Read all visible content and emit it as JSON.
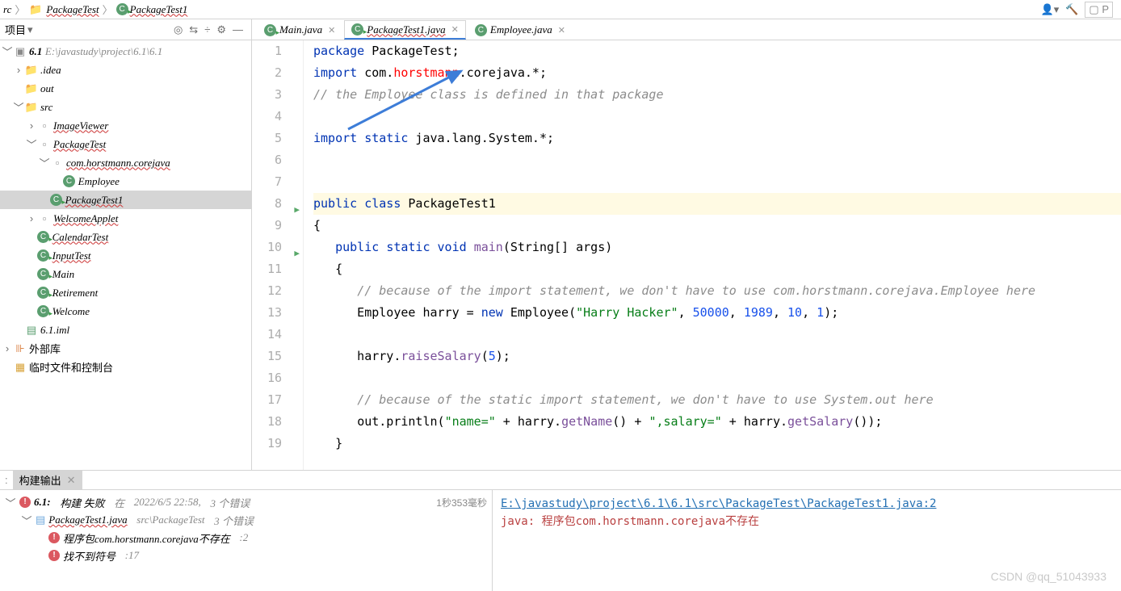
{
  "breadcrumb": {
    "items": [
      "rc",
      "PackageTest",
      "PackageTest1"
    ]
  },
  "sidebar": {
    "title": "项目",
    "project": {
      "name": "6.1",
      "path": "E:\\javastudy\\project\\6.1\\6.1"
    },
    "tree": {
      "idea": ".idea",
      "out": "out",
      "src": "src",
      "imageviewer": "ImageViewer",
      "packageTest": "PackageTest",
      "comHorstmann": "com.horstmann.corejava",
      "employee": "Employee",
      "packageTest1": "PackageTest1",
      "welcomeApplet": "WelcomeApplet",
      "calendarTest": "CalendarTest",
      "inputTest": "InputTest",
      "main": "Main",
      "retirement": "Retirement",
      "welcome": "Welcome",
      "iml": "6.1.iml",
      "extLib": "外部库",
      "scratch": "临时文件和控制台"
    }
  },
  "tabs": [
    {
      "label": "Main.java",
      "active": false
    },
    {
      "label": "PackageTest1.java",
      "active": true
    },
    {
      "label": "Employee.java",
      "active": false
    }
  ],
  "code": {
    "lines": [
      {
        "n": 1,
        "seg": [
          [
            "kw",
            "package"
          ],
          [
            "",
            " PackageTest;"
          ]
        ]
      },
      {
        "n": 2,
        "seg": [
          [
            "kw",
            "import"
          ],
          [
            "",
            " com."
          ],
          [
            "err",
            "horstmann"
          ],
          [
            "",
            ".corejava.*;"
          ]
        ]
      },
      {
        "n": 3,
        "seg": [
          [
            "cmt",
            "// the Employee class is defined in that package"
          ]
        ]
      },
      {
        "n": 4,
        "seg": [
          [
            "",
            ""
          ]
        ]
      },
      {
        "n": 5,
        "seg": [
          [
            "kw",
            "import"
          ],
          [
            "",
            " "
          ],
          [
            "kw",
            "static"
          ],
          [
            "",
            " java.lang.System.*;"
          ]
        ]
      },
      {
        "n": 6,
        "seg": [
          [
            "",
            ""
          ]
        ]
      },
      {
        "n": 7,
        "seg": [
          [
            "",
            ""
          ]
        ]
      },
      {
        "n": 8,
        "seg": [
          [
            "kw",
            "public"
          ],
          [
            "",
            " "
          ],
          [
            "kw",
            "class"
          ],
          [
            "",
            " "
          ],
          [
            "cls-ref",
            "PackageTest1"
          ]
        ],
        "cur": true,
        "run": true
      },
      {
        "n": 9,
        "seg": [
          [
            "",
            "{"
          ]
        ]
      },
      {
        "n": 10,
        "seg": [
          [
            "",
            "   "
          ],
          [
            "kw",
            "public"
          ],
          [
            "",
            " "
          ],
          [
            "kw",
            "static"
          ],
          [
            "",
            " "
          ],
          [
            "kw",
            "void"
          ],
          [
            "",
            " "
          ],
          [
            "mth",
            "main"
          ],
          [
            "",
            "(String[] args)"
          ]
        ],
        "run": true
      },
      {
        "n": 11,
        "seg": [
          [
            "",
            "   {"
          ]
        ]
      },
      {
        "n": 12,
        "seg": [
          [
            "",
            "      "
          ],
          [
            "cmt",
            "// because of the import statement, we don't have to use com.horstmann.corejava.Employee here"
          ]
        ]
      },
      {
        "n": 13,
        "seg": [
          [
            "",
            "      Employee harry = "
          ],
          [
            "kw",
            "new"
          ],
          [
            "",
            " Employee("
          ],
          [
            "str",
            "\"Harry Hacker\""
          ],
          [
            "",
            ", "
          ],
          [
            "num",
            "50000"
          ],
          [
            "",
            ", "
          ],
          [
            "num",
            "1989"
          ],
          [
            "",
            ", "
          ],
          [
            "num",
            "10"
          ],
          [
            "",
            ", "
          ],
          [
            "num",
            "1"
          ],
          [
            "",
            ");"
          ]
        ]
      },
      {
        "n": 14,
        "seg": [
          [
            "",
            ""
          ]
        ]
      },
      {
        "n": 15,
        "seg": [
          [
            "",
            "      harry."
          ],
          [
            "mth",
            "raiseSalary"
          ],
          [
            "",
            "("
          ],
          [
            "num",
            "5"
          ],
          [
            "",
            ");"
          ]
        ]
      },
      {
        "n": 16,
        "seg": [
          [
            "",
            ""
          ]
        ]
      },
      {
        "n": 17,
        "seg": [
          [
            "",
            "      "
          ],
          [
            "cmt",
            "// because of the static import statement, we don't have to use System.out here"
          ]
        ]
      },
      {
        "n": 18,
        "seg": [
          [
            "",
            "      "
          ],
          [
            "",
            "out.println("
          ],
          [
            "str",
            "\"name=\""
          ],
          [
            "",
            " + harry."
          ],
          [
            "mth",
            "getName"
          ],
          [
            "",
            "() + "
          ],
          [
            "str",
            "\",salary=\""
          ],
          [
            "",
            " + harry."
          ],
          [
            "mth",
            "getSalary"
          ],
          [
            "",
            "());"
          ]
        ]
      },
      {
        "n": 19,
        "seg": [
          [
            "",
            "   }"
          ]
        ]
      }
    ]
  },
  "bottom": {
    "tabLabel": "构建输出",
    "build": {
      "project": "6.1:",
      "status": "构建 失败",
      "at": "在",
      "time": "2022/6/5 22:58,",
      "errcount": "3 个错误",
      "duration": "1秒353毫秒"
    },
    "file": {
      "name": "PackageTest1.java",
      "path": "src\\PackageTest",
      "errcount": "3 个错误"
    },
    "err1": {
      "msg": "程序包com.horstmann.corejava不存在",
      "loc": ":2"
    },
    "err2": {
      "msg": "找不到符号",
      "loc": ":17"
    },
    "detail": {
      "link": "E:\\javastudy\\project\\6.1\\6.1\\src\\PackageTest\\PackageTest1.java:2",
      "error": "java: 程序包com.horstmann.corejava不存在"
    }
  },
  "watermark": "CSDN @qq_51043933"
}
